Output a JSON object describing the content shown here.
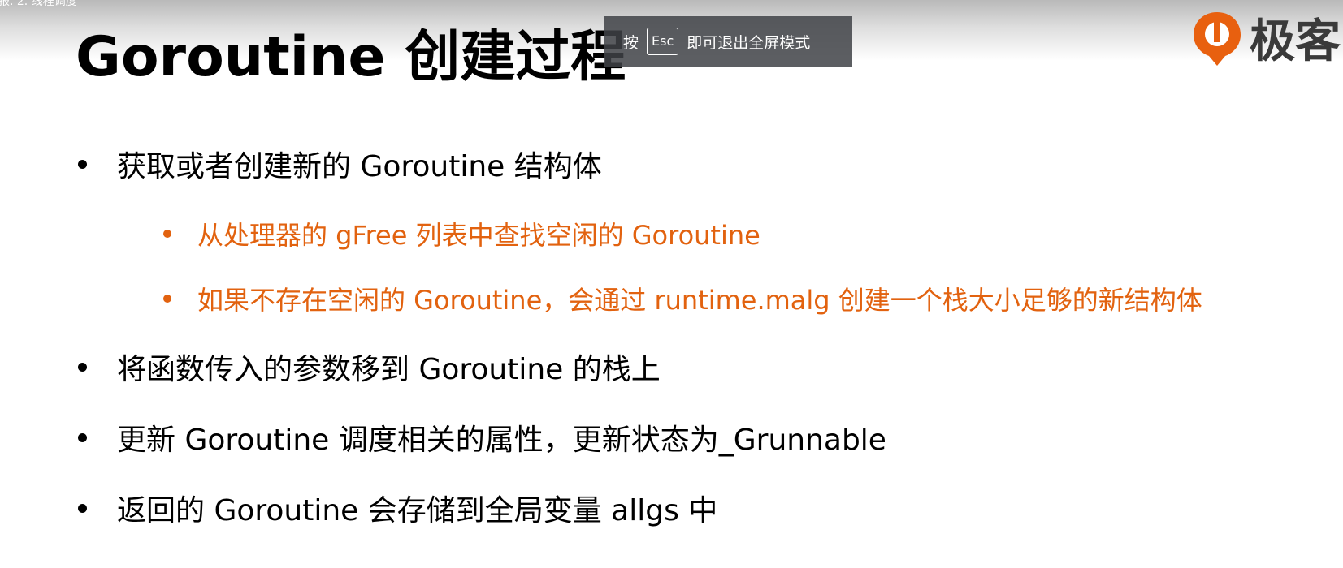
{
  "window": {
    "title": "报. 2. 线程调度"
  },
  "slide": {
    "title": "Goroutine 创建过程",
    "bullets": [
      {
        "level": 1,
        "text": "获取或者创建新的 Goroutine 结构体"
      },
      {
        "level": 2,
        "text": "从处理器的 gFree 列表中查找空闲的 Goroutine"
      },
      {
        "level": 2,
        "text": "如果不存在空闲的 Goroutine，会通过 runtime.malg 创建一个栈大小足够的新结构体"
      },
      {
        "level": 1,
        "text": "将函数传入的参数移到 Goroutine 的栈上"
      },
      {
        "level": 1,
        "text": "更新 Goroutine 调度相关的属性，更新状态为_Grunnable"
      },
      {
        "level": 1,
        "text": "返回的 Goroutine 会存储到全局变量 allgs 中"
      }
    ]
  },
  "fullscreen_toast": {
    "prefix": "按",
    "key": "Esc",
    "suffix": "即可退出全屏模式"
  },
  "logo": {
    "icon": "geekbang-logo-icon",
    "text": "极客"
  },
  "colors": {
    "title": "#000000",
    "body": "#000000",
    "accent": "#e2620f",
    "logo_orange": "#e8600f"
  }
}
